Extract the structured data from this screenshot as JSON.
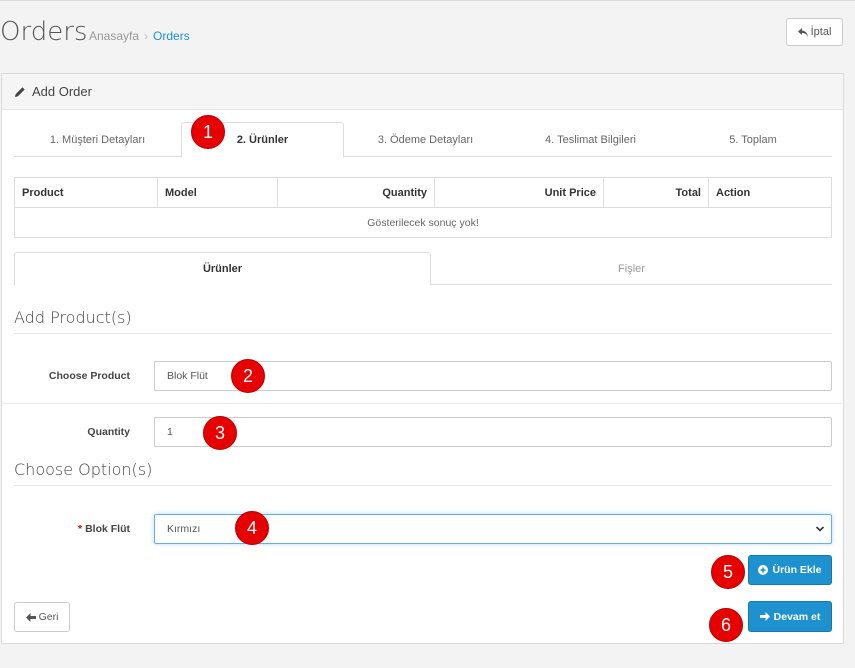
{
  "header": {
    "title": "Orders",
    "breadcrumb": {
      "home": "Anasayfa",
      "separator": "›",
      "current": "Orders"
    },
    "cancel_label": "İptal"
  },
  "panel": {
    "heading": "Add Order"
  },
  "tabs": [
    {
      "label": "1. Müşteri Detayları"
    },
    {
      "label": "2. Ürünler"
    },
    {
      "label": "3. Ödeme Detayları"
    },
    {
      "label": "4. Teslimat Bilgileri"
    },
    {
      "label": "5. Toplam"
    }
  ],
  "cart_table": {
    "headers": [
      "Product",
      "Model",
      "Quantity",
      "Unit Price",
      "Total",
      "Action"
    ],
    "empty_message": "Gösterilecek sonuç yok!"
  },
  "subtabs": [
    {
      "label": "Ürünler"
    },
    {
      "label": "Fişler"
    }
  ],
  "add_product": {
    "legend": "Add Product(s)",
    "product_label": "Choose Product",
    "product_value": "Blok Flüt",
    "quantity_label": "Quantity",
    "quantity_value": "1"
  },
  "options": {
    "legend": "Choose Option(s)",
    "required_mark": "*",
    "option_label": "Blok Flüt",
    "option_value": "Kırmızı"
  },
  "buttons": {
    "add_product": "Ürün Ekle",
    "back": "Geri",
    "continue": "Devam et"
  },
  "annotations": [
    "1",
    "2",
    "3",
    "4",
    "5",
    "6"
  ],
  "colors": {
    "accent": "#1e91cf",
    "badge": "#e60000",
    "required": "#dd0000"
  }
}
